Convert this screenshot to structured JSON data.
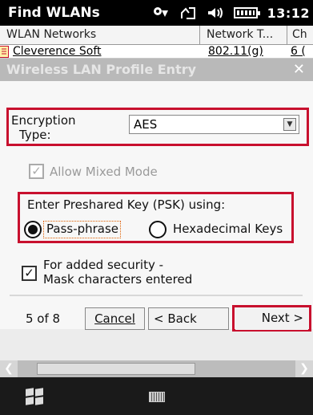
{
  "statusbar": {
    "app_title": "Find WLANs",
    "time": "13:12",
    "icons": [
      "network-icon",
      "signal-icon",
      "volume-icon",
      "battery-icon"
    ]
  },
  "list": {
    "columns": [
      "WLAN Networks",
      "Network T...",
      "Ch"
    ],
    "rows": [
      {
        "name": "Cleverence Soft",
        "type": "802.11(g)",
        "channel": "6 ("
      }
    ]
  },
  "dialog": {
    "title": "Wireless LAN Profile Entry",
    "close": "✕",
    "encryption_label_line1": "Encryption",
    "encryption_label_line2": "Type:",
    "encryption_value": "AES",
    "allow_mixed_label": "Allow Mixed Mode",
    "psk_heading": "Enter Preshared Key (PSK) using:",
    "radio_passphrase": "Pass-phrase",
    "radio_hex": "Hexadecimal Keys",
    "mask_line1": "For added security -",
    "mask_line2": "Mask characters entered",
    "page_indicator": "5 of 8",
    "cancel_label": "Cancel",
    "back_label": "< Back",
    "next_label": "Next >"
  },
  "accent": "#c8102e"
}
